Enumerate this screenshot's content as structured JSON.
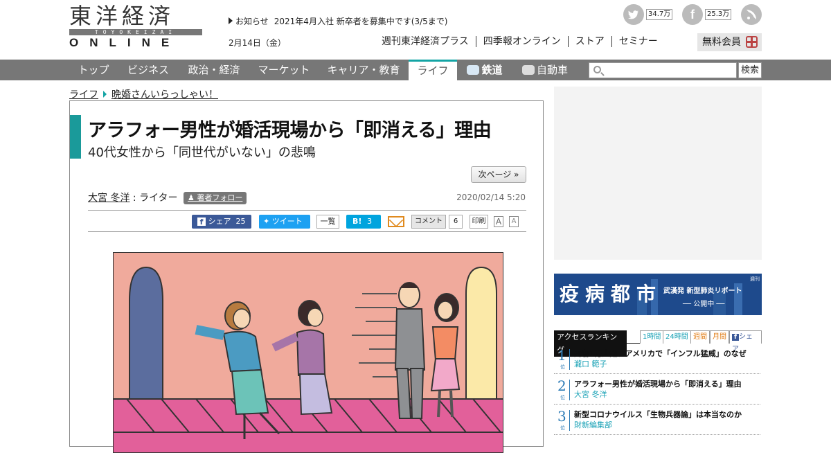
{
  "header": {
    "logo_jp": "東洋経済",
    "logo_roman": "TOYOKEIZAI",
    "logo_en": "ONLINE",
    "notice_label": "お知らせ",
    "notice_text": "2021年4月入社 新卒者を募集中です(3/5まで)",
    "date": "2月14日（金）",
    "subnav": [
      "週刊東洋経済プラス",
      "四季報オンライン",
      "ストア",
      "セミナー"
    ],
    "free_member": "無料会員",
    "twitter_count": "34.7万",
    "facebook_count": "25.3万"
  },
  "nav": {
    "items": [
      "トップ",
      "ビジネス",
      "政治・経済",
      "マーケット",
      "キャリア・教育",
      "ライフ",
      "鉄道",
      "自動車"
    ],
    "active": "ライフ",
    "search_button": "検索"
  },
  "breadcrumb": [
    "ライフ",
    "晩婚さんいらっしゃい！"
  ],
  "article": {
    "title": "アラフォー男性が婚活現場から「即消える」理由",
    "subtitle": "40代女性から「同世代がいない」の悲鳴",
    "next_page": "次ページ »",
    "author_name": "大宮 冬洋",
    "author_role": " : ライター",
    "follow": "著者フォロー",
    "published": "2020/02/14 5:20",
    "share": {
      "facebook_label": "シェア",
      "facebook_count": "25",
      "tweet_label": "ツイート",
      "list": "一覧",
      "hatena_label": "B!",
      "hatena_count": "3",
      "comment_label": "コメント",
      "comment_count": "6",
      "print": "印刷",
      "font_large": "A",
      "font_small": "A"
    }
  },
  "sidebar": {
    "banner": {
      "title": "疫病都市",
      "sub": "武漢発 新型肺炎リポート",
      "status": "── 公開中 ──",
      "mark": "週刊"
    },
    "ranking": {
      "title": "アクセスランキング",
      "tabs": [
        "1時間",
        "24時間",
        "週間",
        "月間",
        "シェア"
      ],
      "unit": "位",
      "items": [
        {
          "rank": "1",
          "title": "死者1万人超、アメリカで「インフル猛威」のなぜ",
          "author": "瀧口 範子"
        },
        {
          "rank": "2",
          "title": "アラフォー男性が婚活現場から「即消える」理由",
          "author": "大宮 冬洋"
        },
        {
          "rank": "3",
          "title": "新型コロナウイルス「生物兵器論」は本当なのか",
          "author": "財新編集部"
        }
      ]
    }
  },
  "colors": {
    "accent": "#1a9a9a",
    "nav_bg": "#777777",
    "facebook": "#3b5998",
    "twitter": "#1da1f2",
    "hatena": "#00a4de"
  }
}
